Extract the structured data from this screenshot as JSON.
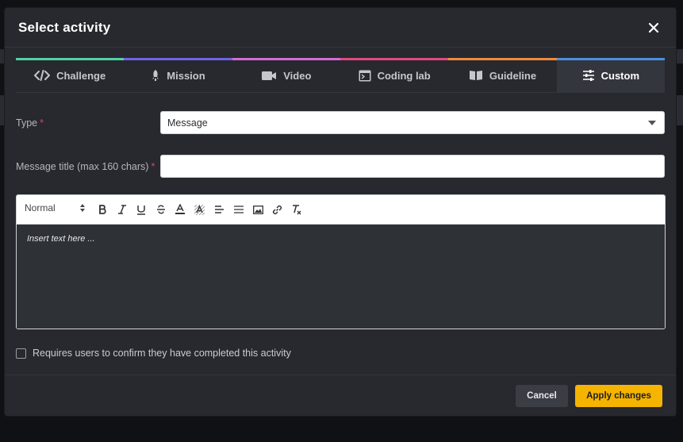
{
  "modal": {
    "title": "Select activity"
  },
  "tabs": [
    {
      "label": "Challenge",
      "icon": "code-icon",
      "color": "#4fd1a5"
    },
    {
      "label": "Mission",
      "icon": "rocket-icon",
      "color": "#6f63e6"
    },
    {
      "label": "Video",
      "icon": "video-camera-icon",
      "color": "#d46bd8"
    },
    {
      "label": "Coding lab",
      "icon": "terminal-window-icon",
      "color": "#e0497f"
    },
    {
      "label": "Guideline",
      "icon": "open-book-icon",
      "color": "#f08a3c"
    },
    {
      "label": "Custom",
      "icon": "sliders-icon",
      "color": "#4a8fe0"
    }
  ],
  "active_tab": "Custom",
  "form": {
    "type_label": "Type",
    "type_value": "Message",
    "title_label": "Message title (max 160 chars)",
    "title_value": "",
    "required_marker": "*"
  },
  "editor": {
    "heading_value": "Normal",
    "placeholder": "Insert text here ...",
    "toolbar_icons": [
      "bold-icon",
      "italic-icon",
      "underline-icon",
      "strikethrough-icon",
      "text-color-icon",
      "highlight-color-icon",
      "align-icon",
      "list-icon",
      "image-icon",
      "link-icon",
      "clear-format-icon"
    ]
  },
  "confirm": {
    "label": "Requires users to confirm they have completed this activity",
    "checked": false
  },
  "footer": {
    "cancel_label": "Cancel",
    "apply_label": "Apply changes"
  },
  "colors": {
    "accent": "#f5b400",
    "required": "#e0425b"
  }
}
